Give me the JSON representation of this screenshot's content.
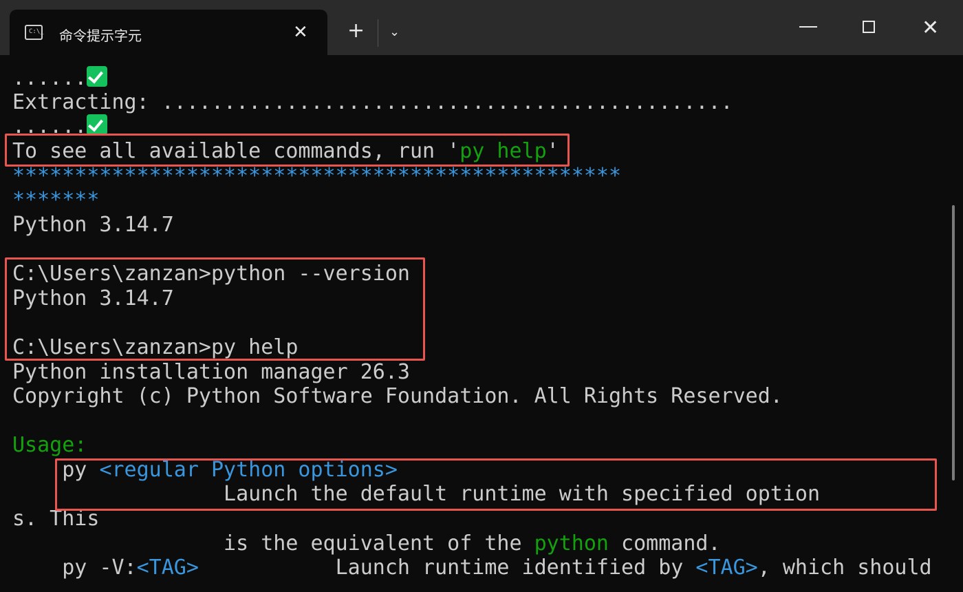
{
  "window": {
    "tab_title": "命令提示字元",
    "tab_icon": "command-prompt-icon",
    "tab_icon_text": "C:\\_",
    "close_tab": "✕",
    "new_tab": "+",
    "dropdown": "⌄",
    "minimize": "minimize-icon",
    "maximize": "maximize-icon",
    "close_window": "✕"
  },
  "terminal": {
    "l1_text": "......",
    "l2_text": "Extracting: ..............................................",
    "l3_text": "......",
    "l4_prefix": "To see all available commands, run '",
    "l4_cmd": "py help",
    "l4_suffix": "'",
    "l5_stars": "*************************************************",
    "l6_stars": "*******",
    "l7_text": "Python 3.14.7",
    "l9_text": "C:\\Users\\zanzan>python --version",
    "l10_text": "Python 3.14.7",
    "l12_text": "C:\\Users\\zanzan>py help",
    "l13_text": "Python installation manager 26.3",
    "l14_text": "Copyright (c) Python Software Foundation. All Rights Reserved.",
    "l16_usage": "Usage:",
    "l17_py": "    py ",
    "l17_opt": "<regular Python options>",
    "l18_text": "                 Launch the default runtime with specified option",
    "l19_text": "s. This",
    "l20_prefix": "                 is the equivalent of the ",
    "l20_python": "python",
    "l20_suffix": " command.",
    "l21_prefix": "    py -V:",
    "l21_tag": "<TAG>",
    "l21_mid": "           Launch runtime identified by ",
    "l21_tag2": "<TAG>",
    "l21_suffix": ", which should"
  },
  "colors": {
    "background": "#0c0c0c",
    "text": "#cccccc",
    "green": "#13a10e",
    "blue": "#3a96dd",
    "highlight": "#e8574f",
    "check": "#15c15d"
  }
}
